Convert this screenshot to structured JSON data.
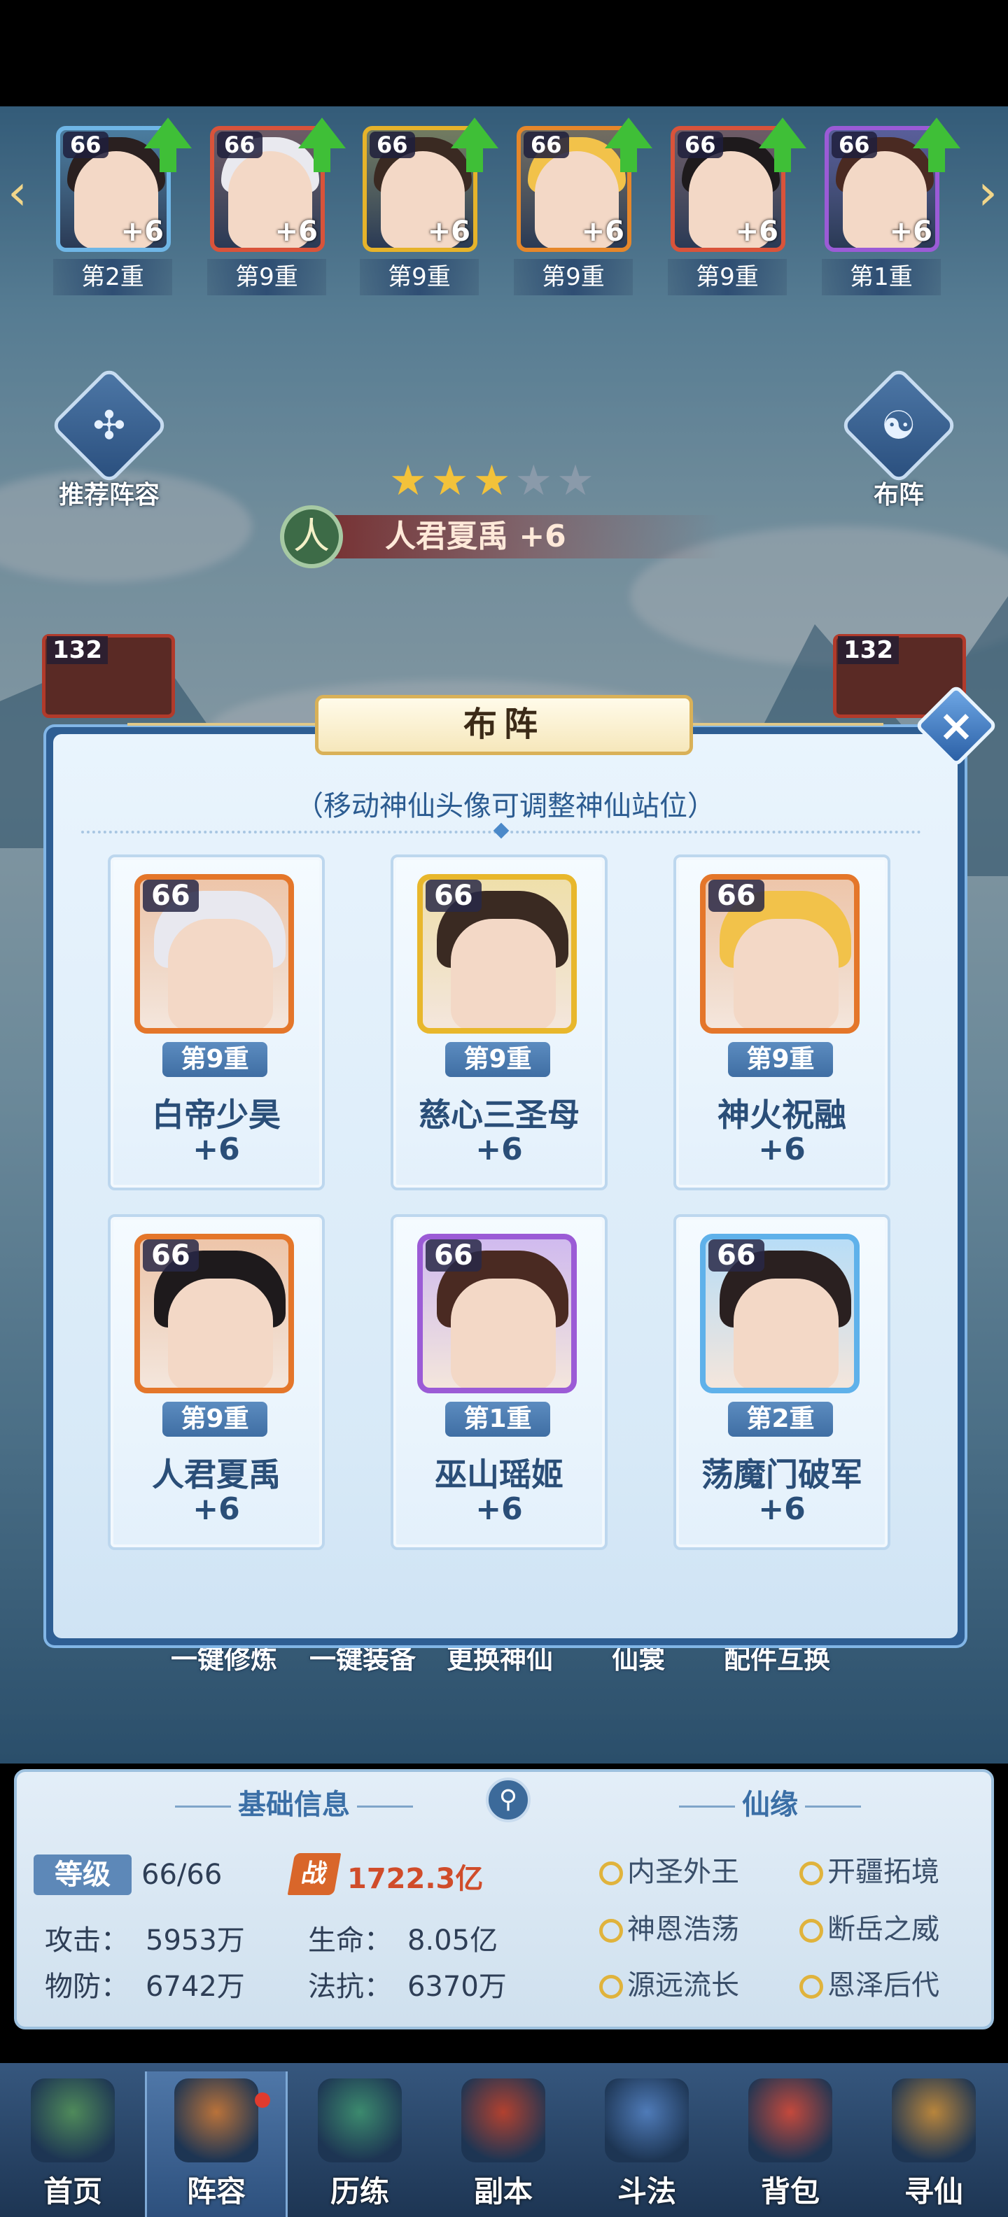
{
  "hero_strip": [
    {
      "level": "66",
      "plus": "+6",
      "rank": "第2重",
      "frame": "#6fb6e6",
      "hair": "#2a2020"
    },
    {
      "level": "66",
      "plus": "+6",
      "rank": "第9重",
      "frame": "#d9533a",
      "hair": "#e9e9ef"
    },
    {
      "level": "66",
      "plus": "+6",
      "rank": "第9重",
      "frame": "#e6b32a",
      "hair": "#3a2a22"
    },
    {
      "level": "66",
      "plus": "+6",
      "rank": "第9重",
      "frame": "#e6872a",
      "hair": "#f2c24a"
    },
    {
      "level": "66",
      "plus": "+6",
      "rank": "第9重",
      "frame": "#d9533a",
      "hair": "#1e1a1c"
    },
    {
      "level": "66",
      "plus": "+6",
      "rank": "第1重",
      "frame": "#9b5bd6",
      "hair": "#4a2a22"
    }
  ],
  "left_button": {
    "label": "推荐阵容",
    "icon": "✣"
  },
  "right_button": {
    "label": "布阵",
    "icon": "☯"
  },
  "stars": {
    "filled": "★★★",
    "empty": "★★"
  },
  "hero_name": {
    "tag": "人",
    "text": "人君夏禹 +6"
  },
  "side_cards": {
    "left_level": "132",
    "right_level": "132"
  },
  "modal": {
    "title": "布阵",
    "close": "×",
    "hint": "（移动神仙头像可调整神仙站位）",
    "slots": [
      {
        "level": "66",
        "tier": "第9重",
        "name": "白帝少昊",
        "plus": "+6",
        "frame": "#e4762a",
        "hair": "#e8e8ef"
      },
      {
        "level": "66",
        "tier": "第9重",
        "name": "慈心三圣母",
        "plus": "+6",
        "frame": "#e8b72c",
        "hair": "#3a2a22"
      },
      {
        "level": "66",
        "tier": "第9重",
        "name": "神火祝融",
        "plus": "+6",
        "frame": "#e4762a",
        "hair": "#f2c24a"
      },
      {
        "level": "66",
        "tier": "第9重",
        "name": "人君夏禹",
        "plus": "+6",
        "frame": "#e4762a",
        "hair": "#1e1a1c"
      },
      {
        "level": "66",
        "tier": "第1重",
        "name": "巫山瑶姬",
        "plus": "+6",
        "frame": "#9b5bd6",
        "hair": "#4a2a22"
      },
      {
        "level": "66",
        "tier": "第2重",
        "name": "荡魔门破军",
        "plus": "+6",
        "frame": "#5fb1ea",
        "hair": "#2a2020"
      }
    ]
  },
  "actions": [
    "一键修炼",
    "一键装备",
    "更换神仙",
    "仙裳",
    "配件互换"
  ],
  "info": {
    "basic_title": "基础信息",
    "fate_title": "仙缘",
    "level_label": "等级",
    "level_value": "66/66",
    "power_icon": "战",
    "power_value": "1722.3亿",
    "attack_label": "攻击：",
    "attack_value": "5953万",
    "hp_label": "生命：",
    "hp_value": "8.05亿",
    "pdef_label": "物防：",
    "pdef_value": "6742万",
    "mdef_label": "法抗：",
    "mdef_value": "6370万",
    "fates": [
      "内圣外王",
      "开疆拓境",
      "神恩浩荡",
      "断岳之威",
      "源远流长",
      "恩泽后代"
    ]
  },
  "nav": [
    {
      "label": "首页",
      "color": "#4f8a5a"
    },
    {
      "label": "阵容",
      "color": "#b9723a"
    },
    {
      "label": "历练",
      "color": "#3c8a6e"
    },
    {
      "label": "副本",
      "color": "#b2412f"
    },
    {
      "label": "斗法",
      "color": "#4f7bb8"
    },
    {
      "label": "背包",
      "color": "#c4493c"
    },
    {
      "label": "寻仙",
      "color": "#b8853c"
    }
  ]
}
